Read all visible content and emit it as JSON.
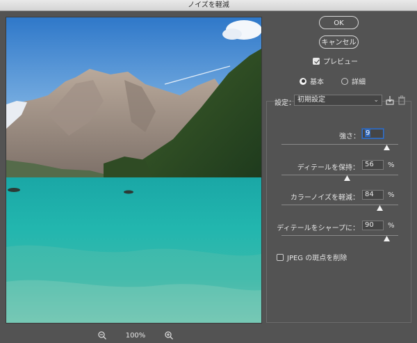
{
  "window": {
    "title": "ノイズを軽減"
  },
  "zoom": {
    "level": "100%"
  },
  "buttons": {
    "ok": "OK",
    "cancel": "キャンセル"
  },
  "preview_toggle": {
    "label": "プレビュー",
    "checked": true
  },
  "mode": {
    "basic": {
      "label": "基本",
      "selected": true
    },
    "advanced": {
      "label": "詳細",
      "selected": false
    }
  },
  "settings": {
    "label": "設定：",
    "value": "初期設定"
  },
  "params": {
    "strength": {
      "label": "強さ：",
      "value": "9",
      "max": 10
    },
    "preserve_details": {
      "label": "ディテールを保持：",
      "value": "56",
      "unit": "%"
    },
    "reduce_color_noise": {
      "label": "カラーノイズを軽減：",
      "value": "84",
      "unit": "%"
    },
    "sharpen_details": {
      "label": "ディテールをシャープに：",
      "value": "90",
      "unit": "%"
    }
  },
  "jpeg_artifact": {
    "label": "JPEG の斑点を削除",
    "checked": false
  },
  "icons": {
    "zoom_out": "zoom-out-icon",
    "zoom_in": "zoom-in-icon",
    "save_preset": "save-preset-icon",
    "delete": "trash-icon"
  },
  "colors": {
    "panel_bg": "#535353",
    "focus": "#3a72c4",
    "water": "#1fb5ad"
  }
}
